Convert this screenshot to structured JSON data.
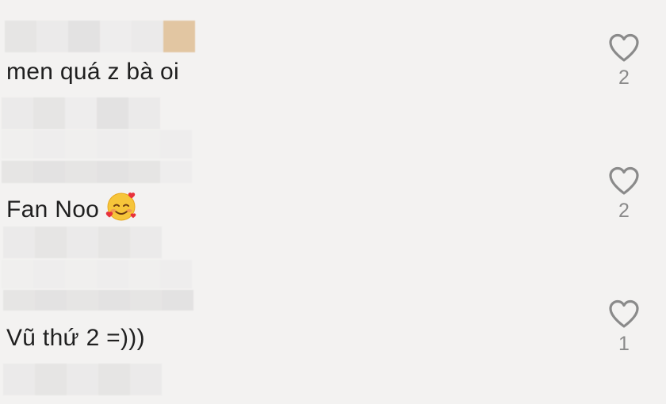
{
  "comments": [
    {
      "text": "men quá z bà oi",
      "likes": "2"
    },
    {
      "text": "Fan Noo",
      "emoji": "smiling-face-with-hearts",
      "likes": "2"
    },
    {
      "text": "Vũ thứ 2 =)))",
      "likes": "1"
    }
  ],
  "icons": {
    "like": "heart-outline-icon"
  },
  "colors": {
    "background": "#f3f2f1",
    "text": "#1f1f1f",
    "like_count": "#8a8a8a"
  }
}
